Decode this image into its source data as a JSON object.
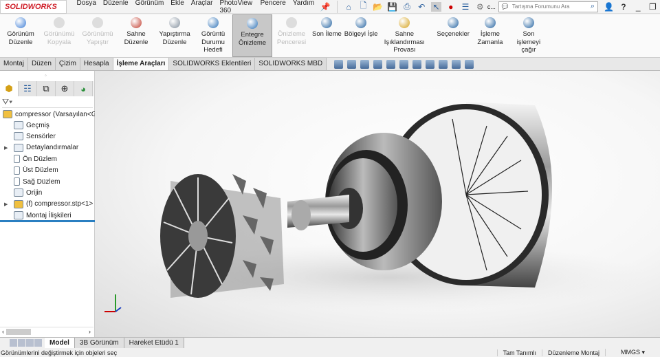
{
  "app": {
    "logo": "SOLIDWORKS"
  },
  "menu": [
    "Dosya",
    "Düzenle",
    "Görünüm",
    "Ekle",
    "Araçlar",
    "PhotoView 360",
    "Pencere",
    "Yardım"
  ],
  "quick_more": "c...",
  "search": {
    "placeholder": "Tartışma Forumunu Ara"
  },
  "ribbon": [
    {
      "label": "Görünüm Düzenle",
      "state": "enabled",
      "color": "#3a7bd5"
    },
    {
      "label": "Görünümü Kopyala",
      "state": "disabled",
      "color": "#cccccc"
    },
    {
      "label": "Görünümü Yapıştır",
      "state": "disabled",
      "color": "#cccccc"
    },
    {
      "label": "Sahne Düzenle",
      "state": "enabled",
      "color": "#c0392b"
    },
    {
      "label": "Yapıştırma Düzenle",
      "state": "enabled",
      "color": "#7f8c9a"
    },
    {
      "label": "Görüntü Durumu Hedefi",
      "state": "enabled",
      "color": "#2a6fb5"
    },
    {
      "label": "Entegre Önizleme",
      "state": "active",
      "color": "#2a6fb5"
    },
    {
      "label": "Önizleme Penceresi",
      "state": "disabled",
      "color": "#cccccc"
    },
    {
      "label": "Son İleme",
      "state": "enabled",
      "color": "#1f5f9e"
    },
    {
      "label": "Bölgeyi İşle",
      "state": "enabled",
      "color": "#1f5f9e"
    },
    {
      "label": "Sahne Işıklandırması Provası",
      "state": "enabled",
      "color": "#d4a017"
    },
    {
      "label": "Seçenekler",
      "state": "enabled",
      "color": "#1f5f9e"
    },
    {
      "label": "İşleme Zamanla",
      "state": "enabled",
      "color": "#1f5f9e"
    },
    {
      "label": "Son işlemeyi çağır",
      "state": "enabled",
      "color": "#1f5f9e"
    }
  ],
  "cm_tabs": [
    {
      "label": "Montaj"
    },
    {
      "label": "Düzen"
    },
    {
      "label": "Çizim"
    },
    {
      "label": "Hesapla"
    },
    {
      "label": "İşleme Araçları",
      "active": true
    },
    {
      "label": "SOLIDWORKS Eklentileri"
    },
    {
      "label": "SOLIDWORKS MBD"
    }
  ],
  "tree": {
    "root": "compressor  (Varsayılan<Gör",
    "items": [
      "Geçmiş",
      "Sensörler",
      "Detaylandırmalar",
      "Ön Düzlem",
      "Üst Düzlem",
      "Sağ Düzlem",
      "Orijin",
      "(f) compressor.stp<1> (V",
      "Montaj İlişkileri"
    ]
  },
  "bottom_tabs": [
    {
      "label": "Model",
      "active": true
    },
    {
      "label": "3B Görünüm"
    },
    {
      "label": "Hareket Etüdü 1"
    }
  ],
  "status": {
    "message": "Görünümlerini değiştirmek için objeleri seç",
    "definition": "Tam Tanımlı",
    "mode": "Düzenleme Montaj",
    "units": "MMGS"
  }
}
